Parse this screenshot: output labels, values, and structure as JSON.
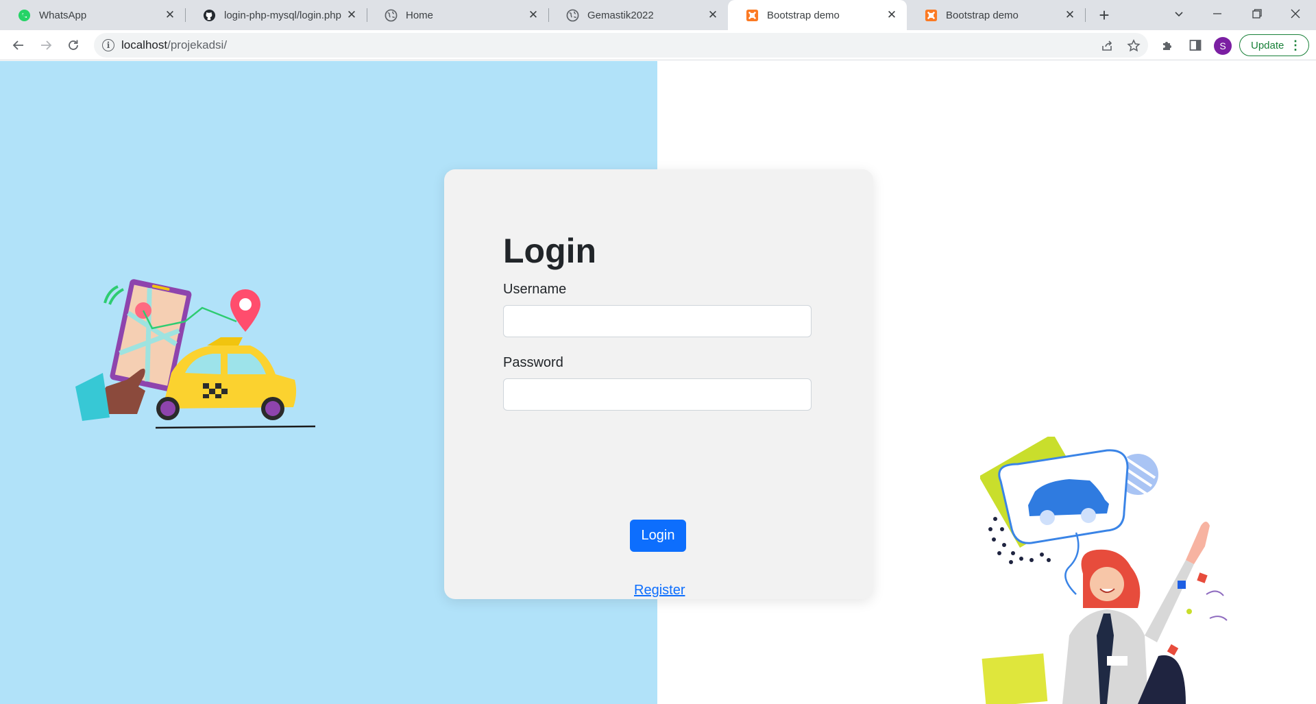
{
  "browser": {
    "tabs": [
      {
        "title": "WhatsApp",
        "icon": "whatsapp-icon"
      },
      {
        "title": "login-php-mysql/login.php",
        "icon": "github-icon"
      },
      {
        "title": "Home",
        "icon": "globe-icon"
      },
      {
        "title": "Gemastik2022",
        "icon": "globe-icon"
      },
      {
        "title": "Bootstrap demo",
        "icon": "xampp-icon",
        "active": true
      },
      {
        "title": "Bootstrap demo",
        "icon": "xampp-icon"
      }
    ],
    "new_tab_label": "+",
    "address": {
      "host": "localhost",
      "path": "/projekadsi/"
    },
    "profile_initial": "S",
    "update_label": "Update",
    "colors": {
      "tabbar": "#dee1e6",
      "update_green": "#188038",
      "avatar": "#7b1fa2"
    }
  },
  "login": {
    "heading": "Login",
    "username_label": "Username",
    "username_value": "",
    "password_label": "Password",
    "password_value": "",
    "submit_label": "Login",
    "register_link": "Register",
    "colors": {
      "left_panel": "#b1e2f9",
      "card": "#f2f2f2",
      "primary": "#0d6efd"
    }
  },
  "illustrations": {
    "left": "taxi-map-illustration",
    "right": "woman-waving-car-illustration"
  }
}
